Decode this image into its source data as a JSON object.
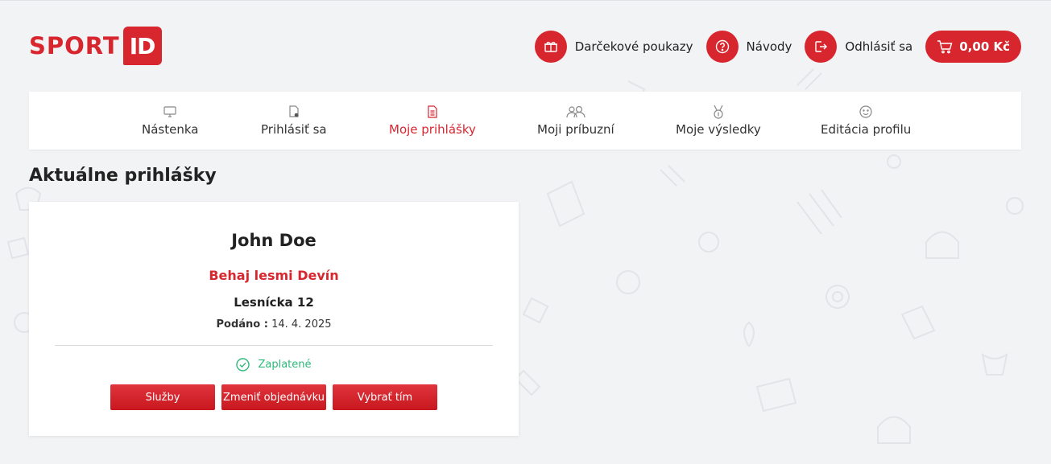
{
  "brand": {
    "logo_sport": "SPORT",
    "logo_id": "ID",
    "accent_color": "#d8262f"
  },
  "header": {
    "actions": [
      {
        "label": "Darčekové poukazy",
        "icon": "gift-card-icon"
      },
      {
        "label": "Návody",
        "icon": "help-icon"
      },
      {
        "label": "Odhlásiť sa",
        "icon": "logout-icon"
      }
    ],
    "cart": {
      "value": "0,00 Kč",
      "icon": "cart-icon"
    }
  },
  "nav": {
    "items": [
      {
        "label": "Nástenka",
        "icon": "monitor-icon",
        "active": false
      },
      {
        "label": "Prihlásiť sa",
        "icon": "document-add-icon",
        "active": false
      },
      {
        "label": "Moje prihlášky",
        "icon": "document-list-icon",
        "active": true
      },
      {
        "label": "Moji príbuzní",
        "icon": "users-icon",
        "active": false
      },
      {
        "label": "Moje výsledky",
        "icon": "medal-icon",
        "active": false
      },
      {
        "label": "Editácia profilu",
        "icon": "smiley-icon",
        "active": false
      }
    ]
  },
  "main": {
    "title": "Aktuálne prihlášky",
    "registration": {
      "name": "John Doe",
      "event": "Behaj lesmi Devín",
      "race": "Lesnícka 12",
      "date_label": "Podáno :",
      "date_value": "14. 4. 2025",
      "status": "Zaplatené",
      "status_color": "#2db87a",
      "buttons": [
        "Služby",
        "Zmeniť objednávku",
        "Vybrať tím"
      ]
    }
  }
}
